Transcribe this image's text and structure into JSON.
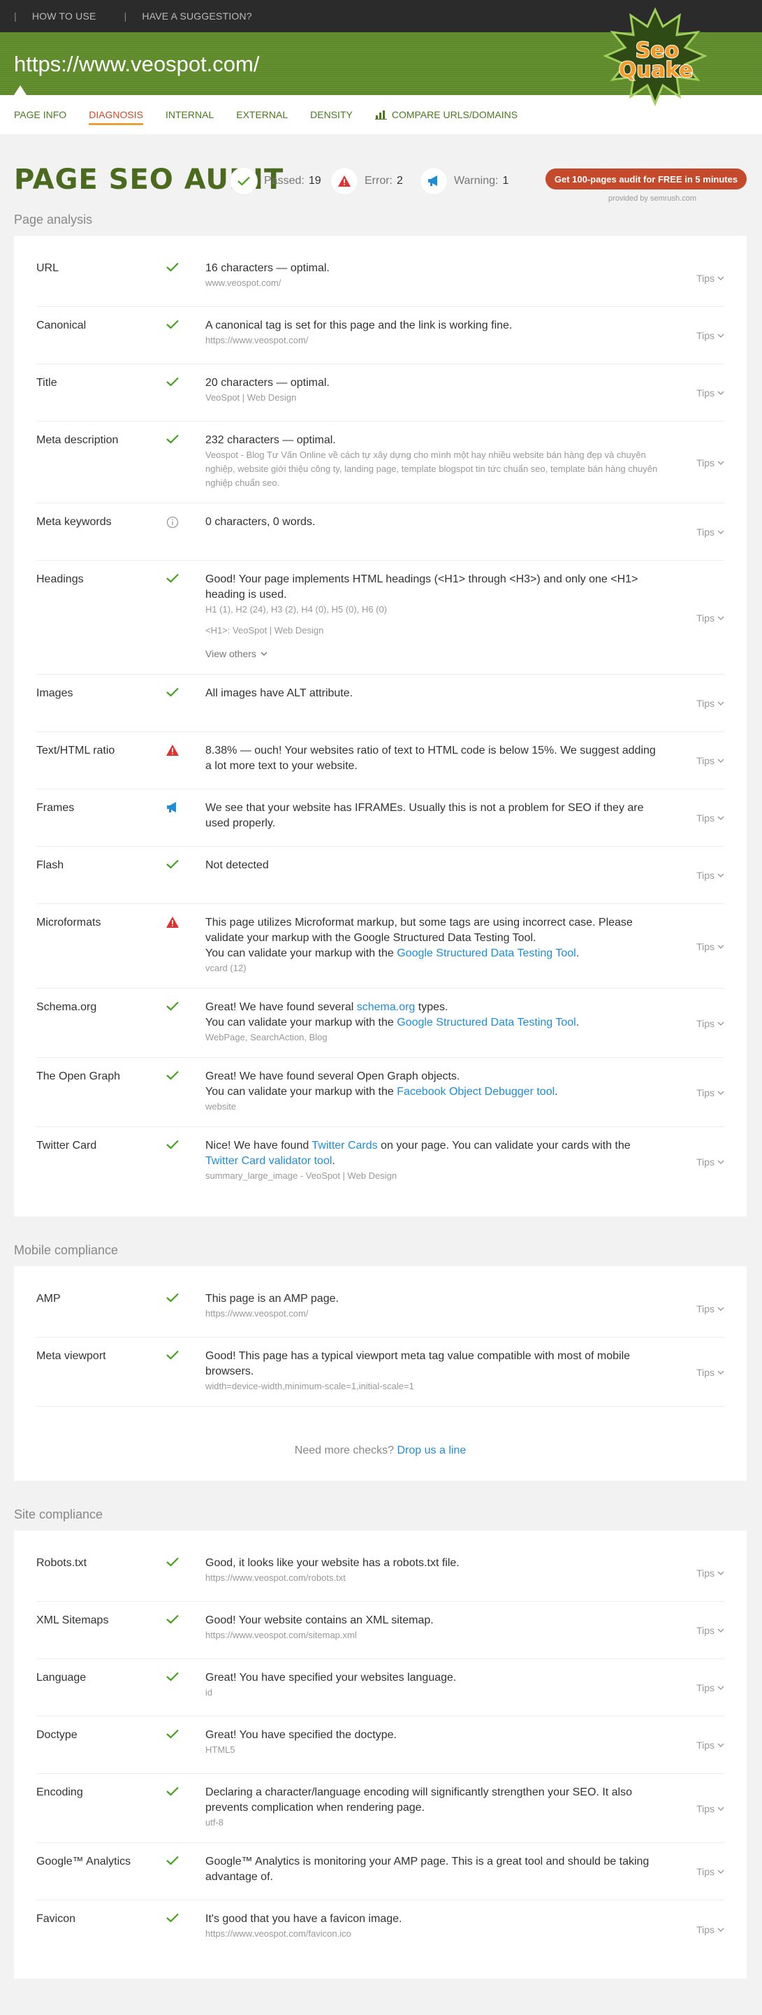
{
  "topbar": {
    "sep": "|",
    "how_to_use": "HOW TO USE",
    "suggestion": "HAVE A SUGGESTION?"
  },
  "header": {
    "url": "https://www.veospot.com/",
    "logo_line1": "Seo",
    "logo_line2": "Quake"
  },
  "nav": {
    "tabs": [
      "PAGE INFO",
      "DIAGNOSIS",
      "INTERNAL",
      "EXTERNAL",
      "DENSITY",
      "COMPARE URLS/DOMAINS"
    ]
  },
  "audit": {
    "title": "PAGE SEO AUDIT",
    "passed_label": "Passed:",
    "passed": "19",
    "error_label": "Error:",
    "error": "2",
    "warning_label": "Warning:",
    "warning": "1",
    "cta": "Get 100-pages audit for FREE in 5 minutes",
    "provided": "provided by  semrush.com"
  },
  "tips_label": "Tips",
  "colors": {
    "pass": "#43a11b",
    "error": "#e03131",
    "warning": "#1f8dd6",
    "info": "#999999"
  },
  "page_analysis": {
    "title": "Page analysis",
    "rows": {
      "url": {
        "label": "URL",
        "text": "16 characters — optimal.",
        "sub": "www.veospot.com/"
      },
      "canonical": {
        "label": "Canonical",
        "text": "A canonical tag is set for this page and the link is working fine.",
        "sub": "https://www.veospot.com/"
      },
      "title": {
        "label": "Title",
        "text": "20 characters — optimal.",
        "sub": "VeoSpot | Web Design"
      },
      "meta_description": {
        "label": "Meta description",
        "text": "232 characters — optimal.",
        "sub": "Veospot - Blog Tư Vấn Online về cách tự xây dựng cho mình một hay nhiều website bán hàng đẹp và chuyên nghiệp, website giới thiệu công ty, landing page, template blogspot tin tức chuẩn seo, template bán hàng chuyên nghiệp chuẩn seo."
      },
      "meta_keywords": {
        "label": "Meta keywords",
        "text": "0 characters, 0 words."
      },
      "headings": {
        "label": "Headings",
        "text": "Good! Your page implements HTML headings (<H1> through <H3>) and only one <H1> heading is used.",
        "sub": "H1 (1), H2 (24), H3 (2), H4 (0), H5 (0), H6 (0)",
        "sub2": "<H1>: VeoSpot | Web Design",
        "view_others": "View others"
      },
      "images": {
        "label": "Images",
        "text": "All images have ALT attribute."
      },
      "text_html": {
        "label": "Text/HTML ratio",
        "text": "8.38% — ouch! Your websites ratio of text to HTML code is below 15%. We suggest adding a lot more text to your website."
      },
      "frames": {
        "label": "Frames",
        "text": "We see that your website has IFRAMEs. Usually this is not a problem for SEO if they are used properly."
      },
      "flash": {
        "label": "Flash",
        "text": "Not detected"
      },
      "microformats": {
        "label": "Microformats",
        "text": "This page utilizes Microformat markup, but some tags are using incorrect case. Please validate your markup with the Google Structured Data Testing Tool.",
        "text2": "You can validate your markup with the ",
        "link": "Google Structured Data Testing Tool",
        "tail": ".",
        "sub": "vcard (12)"
      },
      "schema": {
        "label": "Schema.org",
        "text": "Great! We have found several ",
        "link1": "schema.org",
        "text_b": " types.",
        "text2": "You can validate your markup with the ",
        "link2": "Google Structured Data Testing Tool",
        "tail": ".",
        "sub": "WebPage, SearchAction, Blog"
      },
      "open_graph": {
        "label": "The Open Graph",
        "text": "Great! We have found several Open Graph objects.",
        "text2": "You can validate your markup with the ",
        "link": "Facebook Object Debugger tool",
        "tail": ".",
        "sub": "website"
      },
      "twitter": {
        "label": "Twitter Card",
        "text": "Nice! We have found ",
        "link1": "Twitter Cards",
        "text_b": " on your page. You can validate your cards with the ",
        "link2": "Twitter Card validator tool",
        "tail": ".",
        "sub": "summary_large_image - VeoSpot | Web Design"
      }
    }
  },
  "mobile": {
    "title": "Mobile compliance",
    "rows": {
      "amp": {
        "label": "AMP",
        "text": "This page is an AMP page.",
        "sub": "https://www.veospot.com/"
      },
      "viewport": {
        "label": "Meta viewport",
        "text": "Good! This page has a typical viewport meta tag value compatible with most of mobile browsers.",
        "sub": "width=device-width,minimum-scale=1,initial-scale=1"
      }
    },
    "more_checks": "Need more checks? ",
    "drop_line": "Drop us a line"
  },
  "site": {
    "title": "Site compliance",
    "rows": {
      "robots": {
        "label": "Robots.txt",
        "text": "Good, it looks like your website has a robots.txt file.",
        "sub": "https://www.veospot.com/robots.txt"
      },
      "sitemap": {
        "label": "XML Sitemaps",
        "text": "Good! Your website contains an XML sitemap.",
        "sub": "https://www.veospot.com/sitemap.xml"
      },
      "language": {
        "label": "Language",
        "text": "Great! You have specified your websites language.",
        "sub": "id"
      },
      "doctype": {
        "label": "Doctype",
        "text": "Great! You have specified the doctype.",
        "sub": "HTML5"
      },
      "encoding": {
        "label": "Encoding",
        "text": "Declaring a character/language encoding will significantly strengthen your SEO. It also prevents complication when rendering page.",
        "sub": "utf-8"
      },
      "analytics": {
        "label": "Google™ Analytics",
        "text": "Google™ Analytics is monitoring your AMP page. This is a great tool and should be taking advantage of."
      },
      "favicon": {
        "label": "Favicon",
        "text": "It's good that you have a favicon image.",
        "sub": "https://www.veospot.com/favicon.ico"
      }
    }
  }
}
